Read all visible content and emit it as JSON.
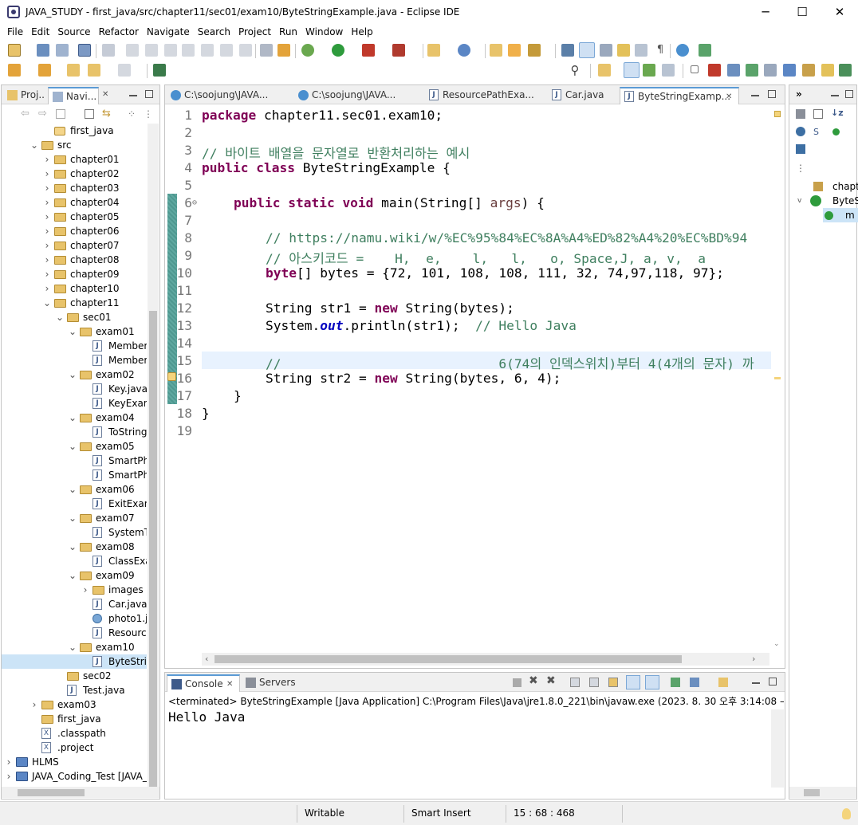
{
  "window": {
    "title": "JAVA_STUDY - first_java/src/chapter11/sec01/exam10/ByteStringExample.java - Eclipse IDE",
    "minimize": "─",
    "maximize": "☐",
    "close": "✕"
  },
  "menu": [
    "File",
    "Edit",
    "Source",
    "Refactor",
    "Navigate",
    "Search",
    "Project",
    "Run",
    "Window",
    "Help"
  ],
  "left_view": {
    "tabs": [
      "Proj...",
      "Navi..."
    ],
    "tree": [
      {
        "label": "first_java",
        "icon": "file",
        "indent": 3,
        "twisty": ""
      },
      {
        "label": "src",
        "icon": "folder",
        "indent": 2,
        "twisty": "v"
      },
      {
        "label": "chapter01",
        "icon": "folder",
        "indent": 3,
        "twisty": ">"
      },
      {
        "label": "chapter02",
        "icon": "folder",
        "indent": 3,
        "twisty": ">"
      },
      {
        "label": "chapter03",
        "icon": "folder",
        "indent": 3,
        "twisty": ">"
      },
      {
        "label": "chapter04",
        "icon": "folder",
        "indent": 3,
        "twisty": ">"
      },
      {
        "label": "chapter05",
        "icon": "folder",
        "indent": 3,
        "twisty": ">"
      },
      {
        "label": "chapter06",
        "icon": "folder",
        "indent": 3,
        "twisty": ">"
      },
      {
        "label": "chapter07",
        "icon": "folder",
        "indent": 3,
        "twisty": ">"
      },
      {
        "label": "chapter08",
        "icon": "folder",
        "indent": 3,
        "twisty": ">"
      },
      {
        "label": "chapter09",
        "icon": "folder",
        "indent": 3,
        "twisty": ">"
      },
      {
        "label": "chapter10",
        "icon": "folder",
        "indent": 3,
        "twisty": ">"
      },
      {
        "label": "chapter11",
        "icon": "folder",
        "indent": 3,
        "twisty": "v"
      },
      {
        "label": "sec01",
        "icon": "folder",
        "indent": 4,
        "twisty": "v"
      },
      {
        "label": "exam01",
        "icon": "folder",
        "indent": 5,
        "twisty": "v"
      },
      {
        "label": "Member.java",
        "icon": "java",
        "indent": 6,
        "twisty": ""
      },
      {
        "label": "MemberExample.java",
        "icon": "java",
        "indent": 6,
        "twisty": ""
      },
      {
        "label": "exam02",
        "icon": "folder",
        "indent": 5,
        "twisty": "v"
      },
      {
        "label": "Key.java",
        "icon": "java",
        "indent": 6,
        "twisty": ""
      },
      {
        "label": "KeyExample.java",
        "icon": "java",
        "indent": 6,
        "twisty": ""
      },
      {
        "label": "exam04",
        "icon": "folder",
        "indent": 5,
        "twisty": "v"
      },
      {
        "label": "ToStringExample.java",
        "icon": "java",
        "indent": 6,
        "twisty": ""
      },
      {
        "label": "exam05",
        "icon": "folder",
        "indent": 5,
        "twisty": "v"
      },
      {
        "label": "SmartPhone.java",
        "icon": "java",
        "indent": 6,
        "twisty": ""
      },
      {
        "label": "SmartPhoneExample.java",
        "icon": "java",
        "indent": 6,
        "twisty": ""
      },
      {
        "label": "exam06",
        "icon": "folder",
        "indent": 5,
        "twisty": "v"
      },
      {
        "label": "ExitExample.java",
        "icon": "java",
        "indent": 6,
        "twisty": ""
      },
      {
        "label": "exam07",
        "icon": "folder",
        "indent": 5,
        "twisty": "v"
      },
      {
        "label": "SystemTimeExample.java",
        "icon": "java",
        "indent": 6,
        "twisty": ""
      },
      {
        "label": "exam08",
        "icon": "folder",
        "indent": 5,
        "twisty": "v"
      },
      {
        "label": "ClassExample.java",
        "icon": "java",
        "indent": 6,
        "twisty": ""
      },
      {
        "label": "exam09",
        "icon": "folder",
        "indent": 5,
        "twisty": "v"
      },
      {
        "label": "images",
        "icon": "folder",
        "indent": 6,
        "twisty": ">"
      },
      {
        "label": "Car.java",
        "icon": "java",
        "indent": 6,
        "twisty": ""
      },
      {
        "label": "photo1.jpg",
        "icon": "image",
        "indent": 6,
        "twisty": ""
      },
      {
        "label": "ResourcePathExample.java",
        "icon": "java",
        "indent": 6,
        "twisty": ""
      },
      {
        "label": "exam10",
        "icon": "folder",
        "indent": 5,
        "twisty": "v"
      },
      {
        "label": "ByteStringExample.java",
        "icon": "java",
        "indent": 6,
        "twisty": "",
        "selected": true
      },
      {
        "label": "sec02",
        "icon": "folder",
        "indent": 4,
        "twisty": ""
      },
      {
        "label": "Test.java",
        "icon": "java",
        "indent": 4,
        "twisty": ""
      },
      {
        "label": "exam03",
        "icon": "folder",
        "indent": 2,
        "twisty": ">"
      },
      {
        "label": "first_java",
        "icon": "folder",
        "indent": 2,
        "twisty": ""
      },
      {
        "label": ".classpath",
        "icon": "xml",
        "indent": 2,
        "twisty": ""
      },
      {
        "label": ".project",
        "icon": "xml",
        "indent": 2,
        "twisty": ""
      },
      {
        "label": "HLMS",
        "icon": "project",
        "indent": 0,
        "twisty": ">"
      },
      {
        "label": "JAVA_Coding_Test [JAVA_",
        "icon": "project",
        "indent": 0,
        "twisty": ">"
      }
    ]
  },
  "editor": {
    "tabs": [
      {
        "label": "C:\\soojung\\JAVA...",
        "icon": "globe"
      },
      {
        "label": "C:\\soojung\\JAVA...",
        "icon": "globe"
      },
      {
        "label": "ResourcePathExa...",
        "icon": "java"
      },
      {
        "label": "Car.java",
        "icon": "java"
      },
      {
        "label": "ByteStringExamp...",
        "icon": "java",
        "active": true
      }
    ],
    "close_glyph": "✕",
    "line_numbers": [
      "1",
      "2",
      "3",
      "4",
      "5",
      "6",
      "7",
      "8",
      "9",
      "10",
      "11",
      "12",
      "13",
      "14",
      "15",
      "16",
      "17",
      "18",
      "19"
    ],
    "code": {
      "l1_kw": "package",
      "l1_rest": " chapter11.sec01.exam10;",
      "l3": "// 바이트 배열을 문자열로 반환처리하는 예시",
      "l4_kw": "public class",
      "l4_rest": " ByteStringExample {",
      "l6_kw": "public static void",
      "l6_a": " main(String[] ",
      "l6_param": "args",
      "l6_b": ") {",
      "l8": "// https://namu.wiki/w/%EC%95%84%EC%8A%A4%ED%82%A4%20%EC%BD%94",
      "l9": "// 아스키코드 =    H,  e,    l,   l,   o, Space,J, a, v,  a",
      "l10_kw": "byte",
      "l10_rest": "[] bytes = {72, 101, 108, 108, 111, 32, 74,97,118, 97};",
      "l12_a": "String str1 = ",
      "l12_kw": "new",
      "l12_b": " String(bytes);",
      "l13_a": "System.",
      "l13_fld": "out",
      "l13_b": ".println(str1);  ",
      "l13_cm": "// Hello Java",
      "l15": "//                            6(74의 인덱스위치)부터 4(4개의 문자) 까",
      "l16_a": "String str2 = ",
      "l16_kw": "new",
      "l16_b": " String(bytes, 6, 4);",
      "l17": "}",
      "l18": "}"
    }
  },
  "console": {
    "tabs": [
      "Console",
      "Servers"
    ],
    "status": "<terminated> ByteStringExample [Java Application] C:\\Program Files\\Java\\jre1.8.0_221\\bin\\javaw.exe  (2023. 8. 30 오후 3:14:08 – 오후 3:1",
    "output": "Hello Java"
  },
  "outline": {
    "items": [
      "chapt",
      "ByteS",
      "m"
    ]
  },
  "statusbar": {
    "writable": "Writable",
    "insert_mode": "Smart Insert",
    "position": "15 : 68 : 468"
  },
  "colors": {
    "keyword": "#7f0055",
    "comment": "#3f7f5f",
    "field": "#0000c0",
    "current_line": "#e8f2fe",
    "accent": "#5b9bd5"
  }
}
